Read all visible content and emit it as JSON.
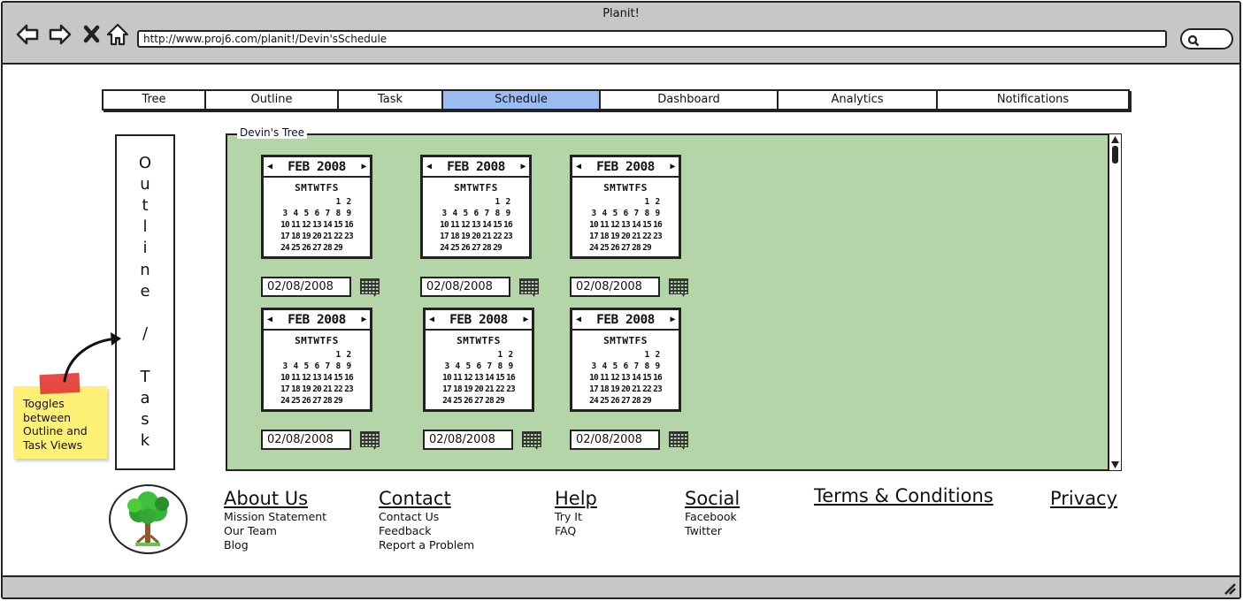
{
  "window": {
    "title": "Planit!",
    "url": "http://www.proj6.com/planit!/Devin'sSchedule"
  },
  "nav": {
    "back_icon": "back-arrow-icon",
    "forward_icon": "forward-arrow-icon",
    "stop_icon": "close-icon",
    "home_icon": "home-icon",
    "search_icon": "search-icon"
  },
  "tabs": [
    {
      "label": "Tree",
      "active": false
    },
    {
      "label": "Outline",
      "active": false
    },
    {
      "label": "Task",
      "active": false
    },
    {
      "label": "Schedule",
      "active": true
    },
    {
      "label": "Dashboard",
      "active": false
    },
    {
      "label": "Analytics",
      "active": false
    },
    {
      "label": "Notifications",
      "active": false
    }
  ],
  "side_toggle": {
    "letters": [
      "O",
      "u",
      "t",
      "l",
      "i",
      "n",
      "e",
      "",
      "/",
      "",
      "T",
      "a",
      "s",
      "k"
    ]
  },
  "sticky_note": {
    "lines": [
      "Toggles",
      "between",
      "Outline and",
      "Task Views"
    ]
  },
  "panel": {
    "legend": "Devin's Tree"
  },
  "calendar": {
    "month": "FEB 2008",
    "weekdays": "SMTWTFS",
    "days": [
      "",
      "",
      "",
      "",
      "",
      "1",
      "2",
      "3",
      "4",
      "5",
      "6",
      "7",
      "8",
      "9",
      "10",
      "11",
      "12",
      "13",
      "14",
      "15",
      "16",
      "17",
      "18",
      "19",
      "20",
      "21",
      "22",
      "23",
      "24",
      "25",
      "26",
      "27",
      "28",
      "29",
      "",
      ""
    ]
  },
  "date_pickers": [
    {
      "value": "02/08/2008"
    },
    {
      "value": "02/08/2008"
    },
    {
      "value": "02/08/2008"
    },
    {
      "value": "02/08/2008"
    },
    {
      "value": "02/08/2008"
    },
    {
      "value": "02/08/2008"
    }
  ],
  "footer": {
    "about": {
      "title": "About Us",
      "links": [
        "Mission Statement",
        "Our Team",
        "Blog"
      ]
    },
    "contact": {
      "title": "Contact",
      "links": [
        "Contact Us",
        "Feedback",
        "Report a Problem"
      ]
    },
    "help": {
      "title": "Help",
      "links": [
        "Try It",
        "FAQ"
      ]
    },
    "social": {
      "title": "Social",
      "links": [
        "Facebook",
        "Twitter"
      ]
    },
    "terms": {
      "title": "Terms & Conditions"
    },
    "privacy": {
      "title": "Privacy"
    }
  },
  "colors": {
    "chrome": "#c7c7c7",
    "active_tab": "#9bbcf2",
    "panel_bg": "#b4d5a8",
    "sticky_note": "#fff176",
    "tape": "#e53935"
  }
}
